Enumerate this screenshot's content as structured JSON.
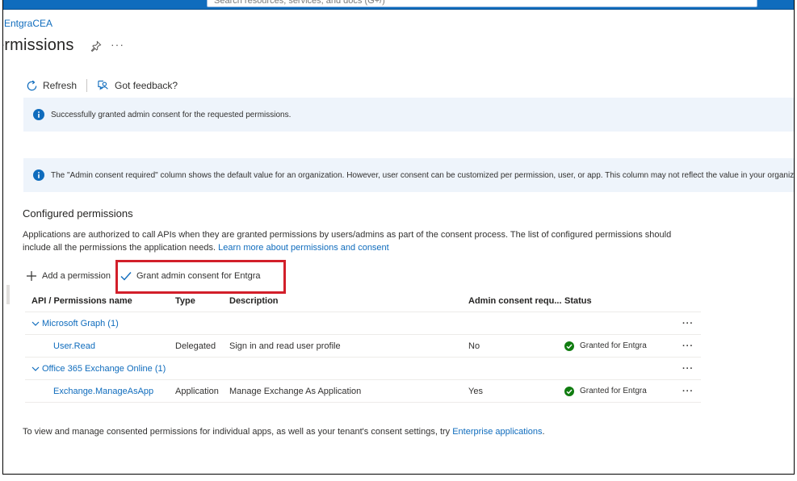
{
  "topbar": {
    "search_placeholder": "Search resources, services, and docs (G+/)"
  },
  "breadcrumb": "EntgraCEA",
  "page_title": "ermissions",
  "title_more": "···",
  "toolbar": {
    "refresh_label": "Refresh",
    "feedback_label": "Got feedback?"
  },
  "banners": {
    "success": "Successfully granted admin consent for the requested permissions.",
    "info": "The \"Admin consent required\" column shows the default value for an organization. However, user consent can be customized per permission, user, or app. This column may not reflect the value in your organizat"
  },
  "section": {
    "title": "Configured permissions",
    "desc_text": "Applications are authorized to call APIs when they are granted permissions by users/admins as part of the consent process. The list of configured permissions should include all the permissions the application needs. ",
    "desc_link": "Learn more about permissions and consent"
  },
  "commands": {
    "add": "Add a permission",
    "grant": "Grant admin consent for Entgra"
  },
  "table": {
    "headers": [
      "API / Permissions name",
      "Type",
      "Description",
      "Admin consent requ...",
      "Status"
    ],
    "more": "···",
    "groups": [
      {
        "name": "Microsoft Graph (1)",
        "permission": {
          "name": "User.Read",
          "type": "Delegated",
          "description": "Sign in and read user profile",
          "admin": "No",
          "status": "Granted for Entgra"
        }
      },
      {
        "name": "Office 365 Exchange Online (1)",
        "permission": {
          "name": "Exchange.ManageAsApp",
          "type": "Application",
          "description": "Manage Exchange As Application",
          "admin": "Yes",
          "status": "Granted for Entgra"
        }
      }
    ]
  },
  "footer": {
    "text": "To view and manage consented permissions for individual apps, as well as your tenant's consent settings, try ",
    "link": "Enterprise applications",
    "suffix": "."
  },
  "colors": {
    "accent": "#0f6cbd",
    "highlight": "#d21f2a",
    "success": "#107c10",
    "banner_bg": "#eef4fb"
  }
}
